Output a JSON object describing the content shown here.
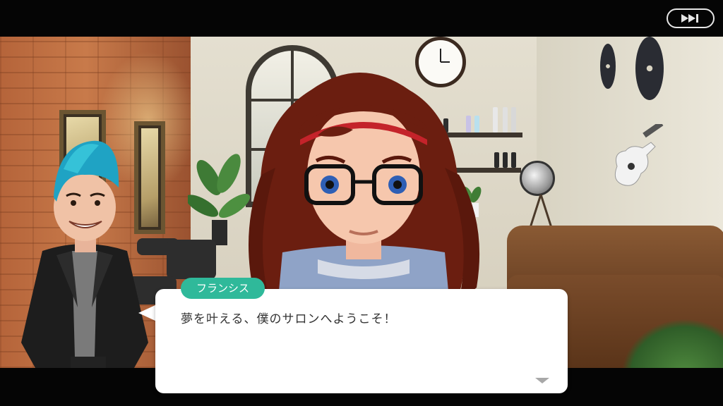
{
  "skip_button": {
    "icon": "fast-forward-icon"
  },
  "dialog": {
    "speaker": "フランシス",
    "text": "夢を叶える、僕のサロンへようこそ！",
    "advance_icon": "chevron-down-icon"
  },
  "colors": {
    "name_tag": "#2fb99a",
    "dialog_bg": "#ffffff",
    "dialog_text": "#333333",
    "letterbox": "#050505"
  }
}
